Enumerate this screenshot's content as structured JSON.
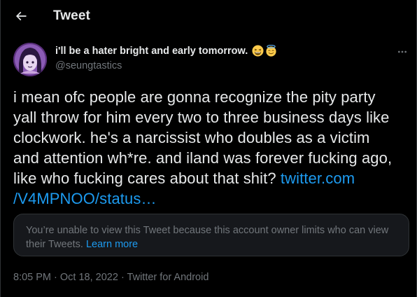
{
  "header": {
    "title": "Tweet",
    "back_icon": "back-arrow-icon"
  },
  "author": {
    "display_name": "i'll be a hater bright and early tomorrow.",
    "emojis": [
      "grinning-squinting-face-emoji",
      "smiling-face-with-halo-emoji"
    ],
    "handle": "@seungtastics",
    "avatar": "user-avatar"
  },
  "more_icon": "more-horizontal-icon",
  "tweet": {
    "text_line1": "i mean ofc people are gonna recognize the pity party",
    "text_line2": "yall throw for him every two to three business days like",
    "text_line3": "clockwork. he's a narcissist who doubles as a victim",
    "text_line4": "and attention wh*re. and iland was forever fucking ago,",
    "text_line5": "like who fucking cares about that shit? ",
    "link_part1": "twitter.com",
    "link_part2": "/V4MPNOO/status…"
  },
  "notice": {
    "text": "You’re unable to view this Tweet because this account owner limits who can view their Tweets.",
    "learn_more": "Learn more"
  },
  "meta": {
    "time": "8:05 PM",
    "separator": " · ",
    "date": "Oct 18, 2022",
    "source": "Twitter for Android"
  },
  "colors": {
    "background": "#000000",
    "text": "#e7e9ea",
    "secondary": "#71767b",
    "link": "#1d9bf0",
    "border": "#2f3336"
  }
}
